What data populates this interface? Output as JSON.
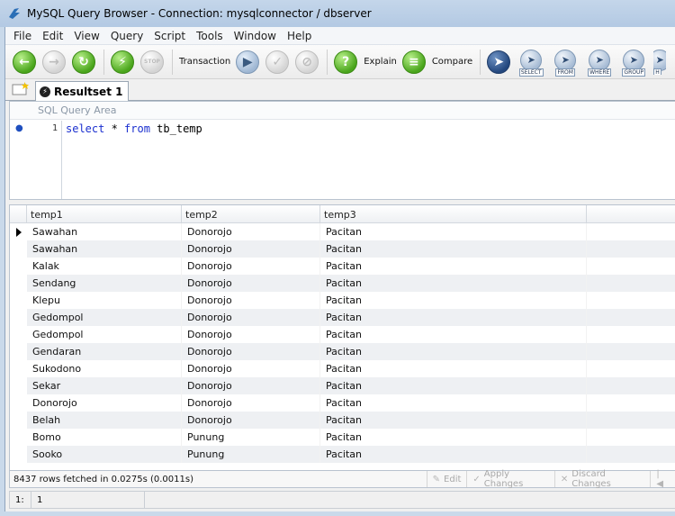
{
  "window": {
    "title": "MySQL Query Browser - Connection: mysqlconnector / dbserver"
  },
  "menu": [
    "File",
    "Edit",
    "View",
    "Query",
    "Script",
    "Tools",
    "Window",
    "Help"
  ],
  "toolbar": {
    "transaction_label": "Transaction",
    "explain_label": "Explain",
    "compare_label": "Compare",
    "keyword_buttons": [
      "SELECT",
      "FROM",
      "WHERE",
      "GROUP",
      "H"
    ]
  },
  "tab": {
    "label": "Resultset 1"
  },
  "query": {
    "header": "SQL Query Area",
    "line_number": "1",
    "sql_keywords": [
      "select",
      "from"
    ],
    "sql_parts": [
      "select",
      " * ",
      "from",
      " tb_temp"
    ]
  },
  "grid": {
    "columns": [
      "temp1",
      "temp2",
      "temp3"
    ],
    "rows": [
      [
        "Sawahan",
        "Donorojo",
        "Pacitan"
      ],
      [
        "Sawahan",
        "Donorojo",
        "Pacitan"
      ],
      [
        "Kalak",
        "Donorojo",
        "Pacitan"
      ],
      [
        "Sendang",
        "Donorojo",
        "Pacitan"
      ],
      [
        "Klepu",
        "Donorojo",
        "Pacitan"
      ],
      [
        "Gedompol",
        "Donorojo",
        "Pacitan"
      ],
      [
        "Gedompol",
        "Donorojo",
        "Pacitan"
      ],
      [
        "Gendaran",
        "Donorojo",
        "Pacitan"
      ],
      [
        "Sukodono",
        "Donorojo",
        "Pacitan"
      ],
      [
        "Sekar",
        "Donorojo",
        "Pacitan"
      ],
      [
        "Donorojo",
        "Donorojo",
        "Pacitan"
      ],
      [
        "Belah",
        "Donorojo",
        "Pacitan"
      ],
      [
        "Bomo",
        "Punung",
        "Pacitan"
      ],
      [
        "Sooko",
        "Punung",
        "Pacitan"
      ]
    ]
  },
  "results": {
    "info": "8437 rows fetched in 0.0275s (0.0011s)",
    "edit_label": "Edit",
    "apply_label": "Apply Changes",
    "discard_label": "Discard Changes"
  },
  "status": {
    "line_label": "1:",
    "col_value": "1"
  }
}
